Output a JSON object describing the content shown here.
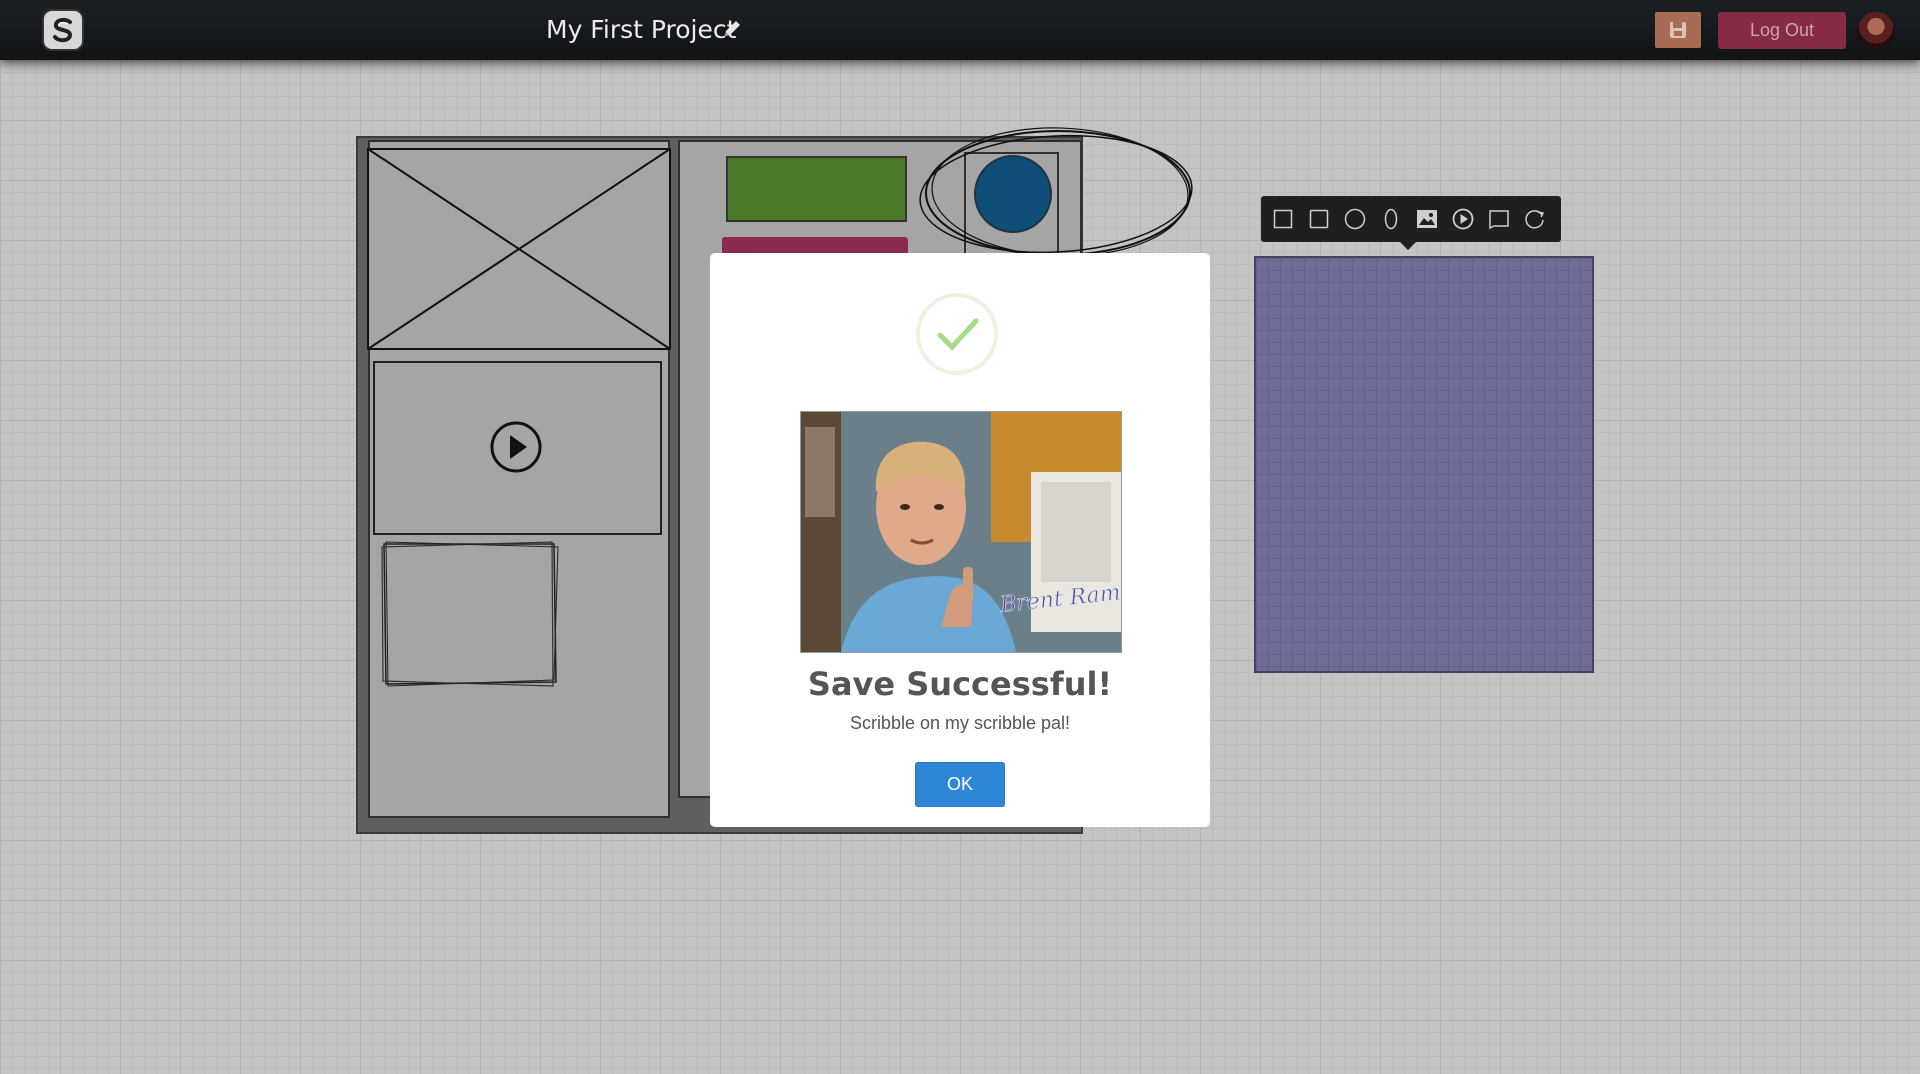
{
  "header": {
    "project_title": "My First Project",
    "logout_label": "Log Out",
    "icons": {
      "logo": "scribble-logo-icon",
      "edit": "pencil-icon",
      "save": "floppy-disk-icon",
      "avatar": "user-avatar"
    }
  },
  "toolbar": {
    "tools": [
      "square-tool-icon",
      "rounded-square-tool-icon",
      "circle-tool-icon",
      "ellipse-tool-icon",
      "image-tool-icon",
      "video-tool-icon",
      "frame-tool-icon",
      "rotate-tool-icon"
    ]
  },
  "modal": {
    "title": "Save Successful!",
    "message": "Scribble on my scribble pal!",
    "ok_label": "OK",
    "signature": "Brent Rambo"
  },
  "colors": {
    "header_bg": "#15191c",
    "save_button": "#a86c52",
    "logout_button": "#862b45",
    "ok_button": "#2f86d8",
    "green_block": "#4a7a28",
    "pink_block": "#8a2a4e",
    "blue_circle": "#0e4e76",
    "purple_panel": "#6f6d97",
    "checkmark": "#a5dc86"
  }
}
